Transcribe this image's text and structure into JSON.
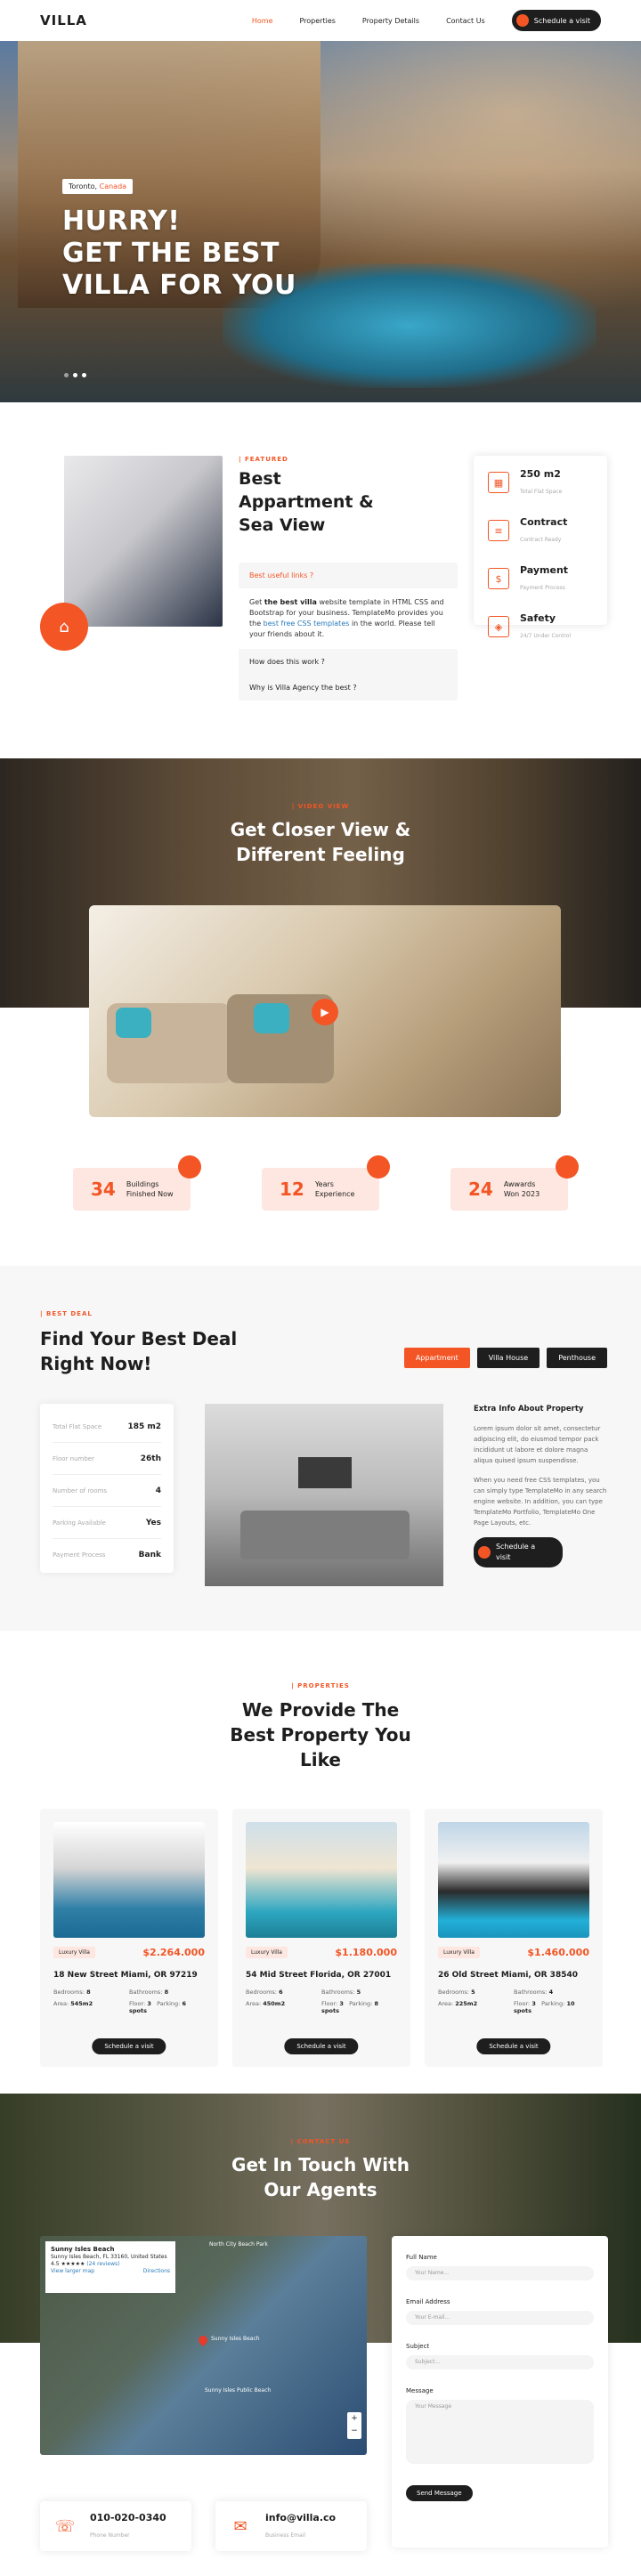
{
  "nav": {
    "logo": "VILLA",
    "items": [
      "Home",
      "Properties",
      "Property Details",
      "Contact Us"
    ],
    "cta": "Schedule a visit"
  },
  "hero": {
    "location_city": "Toronto,",
    "location_country": "Canada",
    "headline": [
      "HURRY!",
      "GET THE BEST",
      "VILLA FOR YOU"
    ]
  },
  "featured": {
    "tag": "| FEATURED",
    "title": [
      "Best",
      "Appartment &",
      "Sea View"
    ],
    "accordion": [
      {
        "q": "Best useful links ?",
        "open": true
      },
      {
        "q": "How does this work ?",
        "open": false
      },
      {
        "q": "Why is Villa Agency the best ?",
        "open": false
      }
    ],
    "answer_start": "Get ",
    "answer_bold": "the best villa",
    "answer_mid": " website template in HTML CSS and Bootstrap for your business. TemplateMo provides you the ",
    "answer_link": "best free CSS templates",
    "answer_end": " in the world. Please tell your friends about it.",
    "info": [
      {
        "title": "250 m2",
        "sub": "Total Flat Space",
        "icon": "area-icon"
      },
      {
        "title": "Contract",
        "sub": "Contract Ready",
        "icon": "contract-icon"
      },
      {
        "title": "Payment",
        "sub": "Payment Process",
        "icon": "payment-icon"
      },
      {
        "title": "Safety",
        "sub": "24/7 Under Control",
        "icon": "safety-icon"
      }
    ]
  },
  "video": {
    "tag": "| VIDEO VIEW",
    "title": [
      "Get Closer View &",
      "Different Feeling"
    ],
    "counters": [
      {
        "num": "34",
        "label": [
          "Buildings",
          "Finished Now"
        ]
      },
      {
        "num": "12",
        "label": [
          "Years",
          "Experience"
        ]
      },
      {
        "num": "24",
        "label": [
          "Awwards",
          "Won 2023"
        ]
      }
    ]
  },
  "deal": {
    "tag": "| BEST DEAL",
    "title": [
      "Find Your Best Deal",
      "Right Now!"
    ],
    "tabs": [
      "Appartment",
      "Villa House",
      "Penthouse"
    ],
    "specs": [
      {
        "k": "Total Flat Space",
        "v": "185 m2"
      },
      {
        "k": "Floor number",
        "v": "26th"
      },
      {
        "k": "Number of rooms",
        "v": "4"
      },
      {
        "k": "Parking Available",
        "v": "Yes"
      },
      {
        "k": "Payment Process",
        "v": "Bank"
      }
    ],
    "info_title": "Extra Info About Property",
    "info_p1": "Lorem ipsum dolor sit amet, consectetur adipiscing elit, do eiusmod tempor pack incididunt ut labore et dolore magna aliqua quised ipsum suspendisse.",
    "info_p2": "When you need free CSS templates, you can simply type TemplateMo in any search engine website. In addition, you can type TemplateMo Portfolio, TemplateMo One Page Layouts, etc.",
    "cta": "Schedule a visit"
  },
  "properties": {
    "tag": "| PROPERTIES",
    "title": [
      "We Provide The",
      "Best Property You",
      "Like"
    ],
    "cards": [
      {
        "badge": "Luxury Villa",
        "price": "$2.264.000",
        "address": "18 New Street Miami, OR 97219",
        "bedrooms": "8",
        "bathrooms": "8",
        "area": "545m2",
        "floor": "3",
        "parking": "6 spots",
        "cta": "Schedule a visit"
      },
      {
        "badge": "Luxury Villa",
        "price": "$1.180.000",
        "address": "54 Mid Street Florida, OR 27001",
        "bedrooms": "6",
        "bathrooms": "5",
        "area": "450m2",
        "floor": "3",
        "parking": "8 spots",
        "cta": "Schedule a visit"
      },
      {
        "badge": "Luxury Villa",
        "price": "$1.460.000",
        "address": "26 Old Street Miami, OR 38540",
        "bedrooms": "5",
        "bathrooms": "4",
        "area": "225m2",
        "floor": "3",
        "parking": "10 spots",
        "cta": "Schedule a visit"
      }
    ],
    "labels": {
      "bedrooms": "Bedrooms:",
      "bathrooms": "Bathrooms:",
      "area": "Area:",
      "floor": "Floor:",
      "parking": "Parking:"
    }
  },
  "contact": {
    "tag": "| CONTACT US",
    "title": [
      "Get In Touch With",
      "Our Agents"
    ],
    "map": {
      "place": "Sunny Isles Beach",
      "place_addr": "Sunny Isles Beach, FL 33160, United States",
      "rating": "4.5 ★★★★★",
      "reviews": "(24 reviews)",
      "larger": "View larger map",
      "directions": "Directions",
      "labels": [
        "North City Beach Park",
        "Sunny Isles Beach",
        "Sunny Isles Public Beach"
      ]
    },
    "form": {
      "name_label": "Full Name",
      "name_ph": "Your Name...",
      "email_label": "Email Address",
      "email_ph": "Your E-mail...",
      "subject_label": "Subject",
      "subject_ph": "Subject...",
      "msg_label": "Message",
      "msg_ph": "Your Message",
      "send": "Send Message"
    },
    "phone": {
      "value": "010-020-0340",
      "label": "Phone Number"
    },
    "email": {
      "value": "info@villa.co",
      "label": "Business Email"
    }
  }
}
